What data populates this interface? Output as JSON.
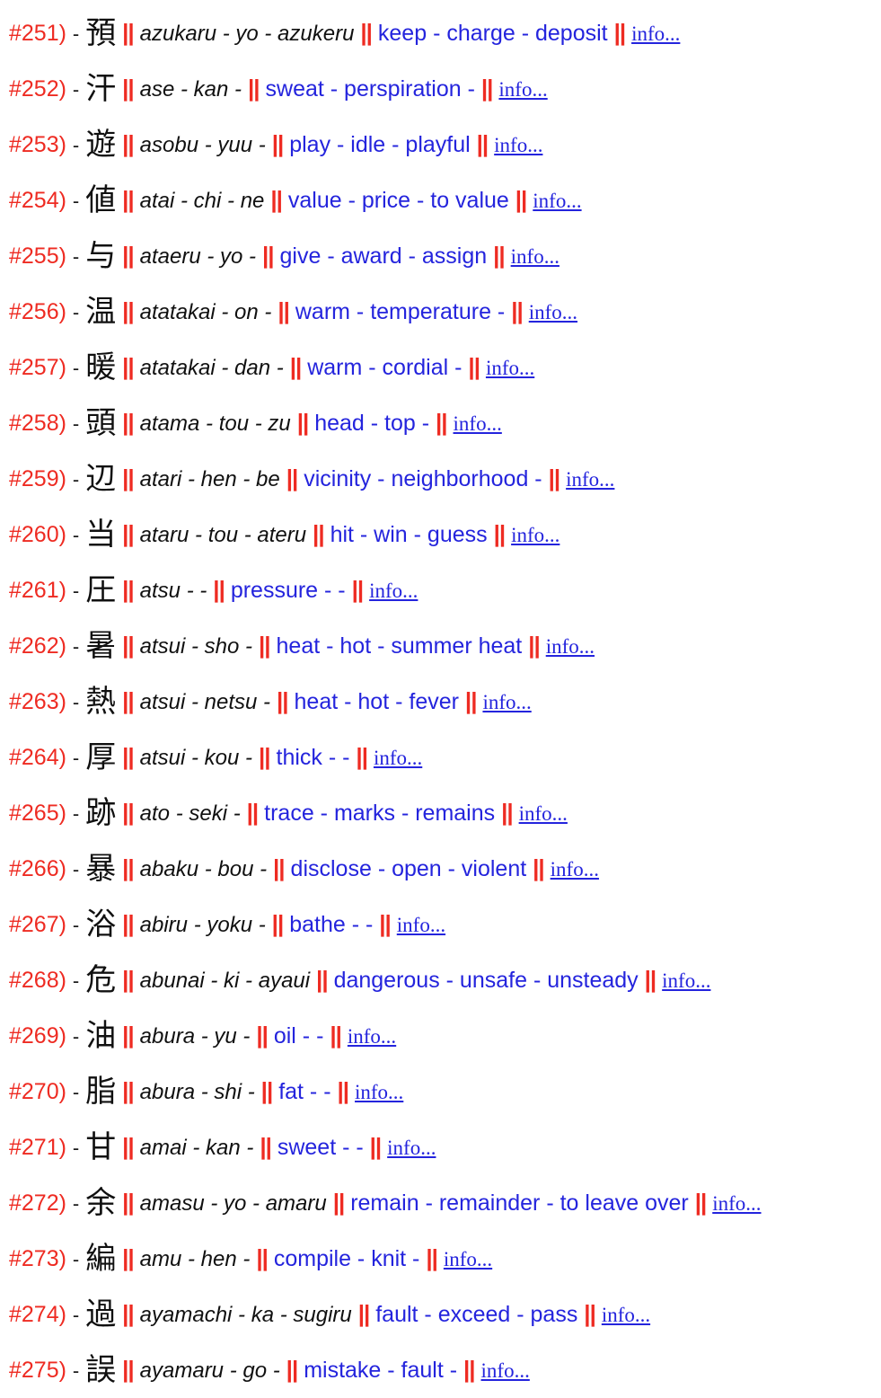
{
  "page": {
    "separator": "||",
    "dash": "-",
    "info_label": "info...",
    "colors": {
      "number": "#ee2b22",
      "separator": "#ee2b22",
      "kanji": "#101010",
      "reading": "#101010",
      "meaning": "#2424dd",
      "link": "#2424dd",
      "background": "#ffffff"
    }
  },
  "entries": [
    {
      "number": "#251)",
      "kanji": "預",
      "reading": "azukaru - yo - azukeru",
      "meaning": "keep - charge - deposit",
      "info": "info..."
    },
    {
      "number": "#252)",
      "kanji": "汗",
      "reading": "ase - kan -",
      "meaning": "sweat - perspiration -",
      "info": "info..."
    },
    {
      "number": "#253)",
      "kanji": "遊",
      "reading": "asobu - yuu -",
      "meaning": "play - idle - playful",
      "info": "info..."
    },
    {
      "number": "#254)",
      "kanji": "値",
      "reading": "atai - chi - ne",
      "meaning": "value - price - to value",
      "info": "info..."
    },
    {
      "number": "#255)",
      "kanji": "与",
      "reading": "ataeru - yo -",
      "meaning": "give - award - assign",
      "info": "info..."
    },
    {
      "number": "#256)",
      "kanji": "温",
      "reading": "atatakai - on -",
      "meaning": "warm - temperature -",
      "info": "info..."
    },
    {
      "number": "#257)",
      "kanji": "暖",
      "reading": "atatakai - dan -",
      "meaning": "warm - cordial -",
      "info": "info..."
    },
    {
      "number": "#258)",
      "kanji": "頭",
      "reading": "atama - tou - zu",
      "meaning": "head - top -",
      "info": "info..."
    },
    {
      "number": "#259)",
      "kanji": "辺",
      "reading": "atari - hen - be",
      "meaning": "vicinity - neighborhood -",
      "info": "info..."
    },
    {
      "number": "#260)",
      "kanji": "当",
      "reading": "ataru - tou - ateru",
      "meaning": "hit - win - guess",
      "info": "info..."
    },
    {
      "number": "#261)",
      "kanji": "圧",
      "reading": "atsu - -",
      "meaning": "pressure - -",
      "info": "info..."
    },
    {
      "number": "#262)",
      "kanji": "暑",
      "reading": "atsui - sho -",
      "meaning": "heat - hot - summer heat",
      "info": "info..."
    },
    {
      "number": "#263)",
      "kanji": "熱",
      "reading": "atsui - netsu -",
      "meaning": "heat - hot - fever",
      "info": "info..."
    },
    {
      "number": "#264)",
      "kanji": "厚",
      "reading": "atsui - kou -",
      "meaning": "thick - -",
      "info": "info..."
    },
    {
      "number": "#265)",
      "kanji": "跡",
      "reading": "ato - seki -",
      "meaning": "trace - marks - remains",
      "info": "info..."
    },
    {
      "number": "#266)",
      "kanji": "暴",
      "reading": "abaku - bou -",
      "meaning": "disclose - open - violent",
      "info": "info..."
    },
    {
      "number": "#267)",
      "kanji": "浴",
      "reading": "abiru - yoku -",
      "meaning": "bathe - -",
      "info": "info..."
    },
    {
      "number": "#268)",
      "kanji": "危",
      "reading": "abunai - ki - ayaui",
      "meaning": "dangerous - unsafe - unsteady",
      "info": "info..."
    },
    {
      "number": "#269)",
      "kanji": "油",
      "reading": "abura - yu -",
      "meaning": "oil - -",
      "info": "info..."
    },
    {
      "number": "#270)",
      "kanji": "脂",
      "reading": "abura - shi -",
      "meaning": "fat - -",
      "info": "info..."
    },
    {
      "number": "#271)",
      "kanji": "甘",
      "reading": "amai - kan -",
      "meaning": "sweet - -",
      "info": "info..."
    },
    {
      "number": "#272)",
      "kanji": "余",
      "reading": "amasu - yo - amaru",
      "meaning": "remain - remainder - to leave over",
      "info": "info..."
    },
    {
      "number": "#273)",
      "kanji": "編",
      "reading": "amu - hen -",
      "meaning": "compile - knit -",
      "info": "info..."
    },
    {
      "number": "#274)",
      "kanji": "過",
      "reading": "ayamachi - ka - sugiru",
      "meaning": "fault - exceed - pass",
      "info": "info..."
    },
    {
      "number": "#275)",
      "kanji": "誤",
      "reading": "ayamaru - go -",
      "meaning": "mistake - fault -",
      "info": "info..."
    }
  ]
}
